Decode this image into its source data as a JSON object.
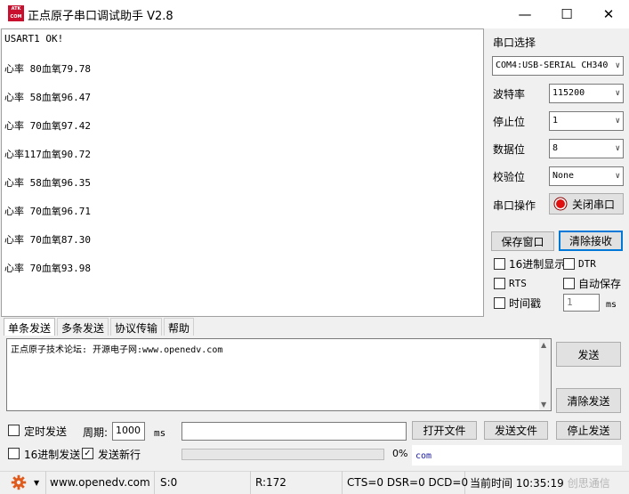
{
  "app": {
    "logo_text": "ATK COM",
    "title": "正点原子串口调试助手 V2.8",
    "controls": {
      "minimize": "—",
      "maximize": "☐",
      "close": "✕"
    }
  },
  "receive": {
    "lines": [
      "USART1 OK!",
      "心率 80血氧79.78",
      "心率 58血氧96.47",
      "心率 70血氧97.42",
      "心率117血氧90.72",
      "心率 58血氧96.35",
      "心率 70血氧96.71",
      "心率 70血氧87.30",
      "心率 70血氧93.98"
    ]
  },
  "serial": {
    "port_select_label": "串口选择",
    "port_value": "COM4:USB-SERIAL CH340",
    "baud_label": "波特率",
    "baud_value": "115200",
    "stopbits_label": "停止位",
    "stopbits_value": "1",
    "databits_label": "数据位",
    "databits_value": "8",
    "parity_label": "校验位",
    "parity_value": "None",
    "operation_label": "串口操作",
    "close_port_label": "关闭串口",
    "status_color": "#e01010"
  },
  "receive_options": {
    "save_window_label": "保存窗口",
    "clear_receive_label": "清除接收",
    "hex_display_label": "16进制显示",
    "dtr_label": "DTR",
    "rts_label": "RTS",
    "auto_save_label": "自动保存",
    "timestamp_label": "时间戳",
    "timestamp_value": "1",
    "timestamp_unit": "ms"
  },
  "tabs": [
    {
      "label": "单条发送",
      "active": true
    },
    {
      "label": "多条发送",
      "active": false
    },
    {
      "label": "协议传输",
      "active": false
    },
    {
      "label": "帮助",
      "active": false
    }
  ],
  "send": {
    "text": "正点原子技术论坛: 开源电子网:www.openedv.com",
    "send_label": "发送",
    "clear_send_label": "清除发送",
    "timed_send_label": "定时发送",
    "period_label": "周期:",
    "period_value": "1000",
    "period_unit": "ms",
    "open_file_label": "打开文件",
    "send_file_label": "发送文件",
    "stop_send_label": "停止发送",
    "hex_send_label": "16进制发送",
    "newline_label": "发送新行",
    "newline_checked": "✓",
    "progress_text": "0%",
    "progress": 0,
    "com_text": "com"
  },
  "status": {
    "gear_color": "#e05a1c",
    "website": "www.openedv.com",
    "sent": "S:0",
    "received": "R:172",
    "signals": "CTS=0 DSR=0 DCD=0",
    "time": "当前时间 10:35:19",
    "watermark": "创思通信"
  }
}
